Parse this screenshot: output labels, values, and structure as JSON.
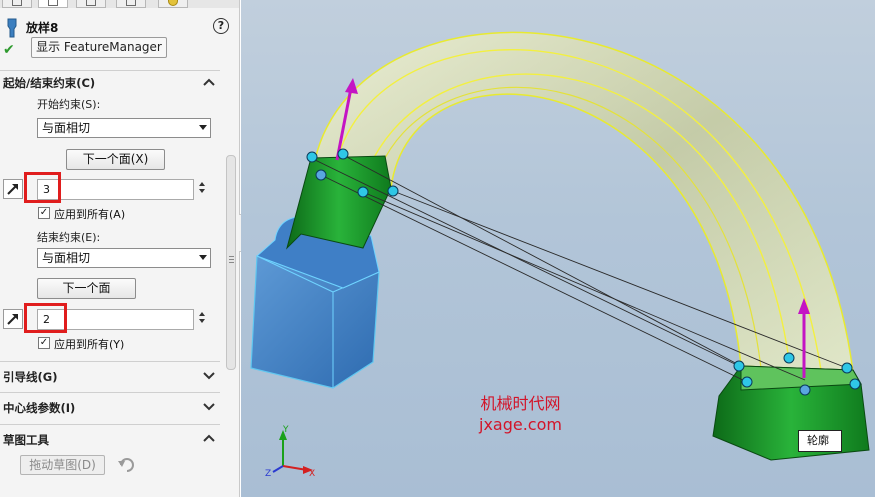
{
  "feature": {
    "title": "放样8",
    "show_featuremanager": "显示 FeatureManager",
    "help_glyph": "?",
    "ok_glyph": "✔"
  },
  "sections": {
    "start_end": {
      "title": "起始/结束约束(C)",
      "start_label": "开始约束(S):",
      "start_value": "与面相切",
      "next_face_1": "下一个面(X)",
      "start_length": "3",
      "apply_all_1": "应用到所有(A)",
      "end_label": "结束约束(E):",
      "end_value": "与面相切",
      "next_face_2": "下一个面",
      "end_length": "2",
      "apply_all_2": "应用到所有(Y)"
    },
    "guides": {
      "title": "引导线(G)"
    },
    "centerline": {
      "title": "中心线参数(I)"
    },
    "sketch_tools": {
      "title": "草图工具",
      "drag_sketch": "拖动草图(D)"
    }
  },
  "viewport": {
    "watermark_cn": "机械时代网",
    "watermark_en": "jxage.com",
    "profile_tag": "轮廓",
    "triad": {
      "y": "Y",
      "z": "Z",
      "x": "X"
    },
    "colors": {
      "background": "#b6c8da",
      "start_block": "#4a86c6",
      "green_section": "#1e9a2e",
      "loft_highlight": "#f0ef3a",
      "vector_arrow": "#c414c4",
      "handle_dot": "#2fc7e6"
    }
  },
  "icons": [
    "help-icon",
    "check-icon",
    "tangent-arrow-icon",
    "chevron-up-icon",
    "chevron-down-icon",
    "undo-icon",
    "triad-icon"
  ]
}
